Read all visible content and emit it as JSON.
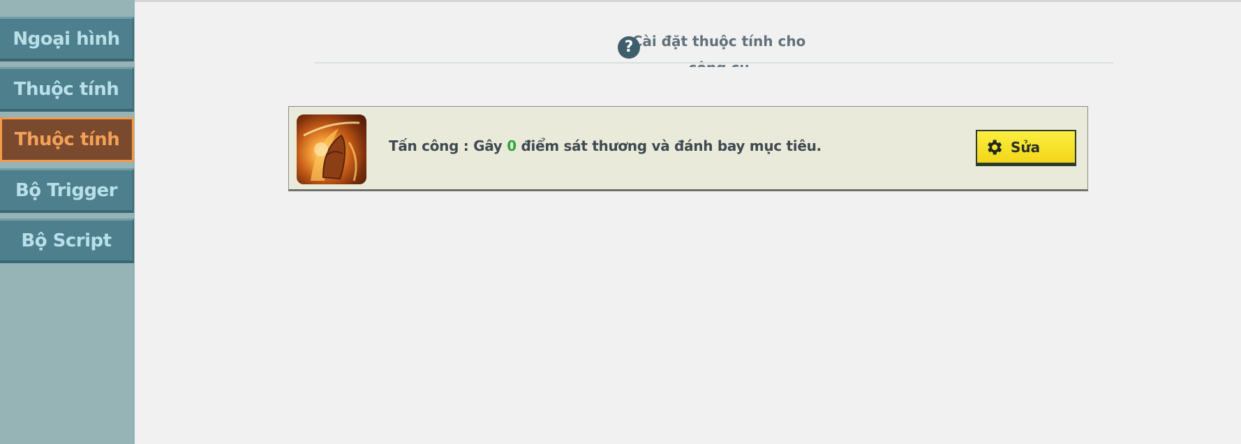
{
  "sidebar": {
    "items": [
      {
        "label": "Ngoại hình",
        "active": false
      },
      {
        "label": "Thuộc tính",
        "active": false
      },
      {
        "label": "Thuộc tính",
        "active": true
      },
      {
        "label": "Bộ Trigger",
        "active": false
      },
      {
        "label": "Bộ Script",
        "active": false
      }
    ]
  },
  "header": {
    "title_line1": "Cài đặt thuộc tính cho",
    "title_line2": "công cụ",
    "help_icon": "question-circle-icon"
  },
  "attribute": {
    "icon": "attack-skill-icon",
    "text_before": "Tấn công : Gây ",
    "value": "0",
    "text_after": " điểm sát thương và đánh bay mục tiêu.",
    "edit_label": "Sửa",
    "edit_icon": "gear-icon"
  },
  "colors": {
    "sidebar_bg": "#96b3b5",
    "tab_bg": "#4d7f8d",
    "tab_active_bg": "#7a4a2f",
    "tab_active_border": "#f49a49",
    "value_green": "#2fa53a",
    "edit_button": "#f2d619"
  }
}
